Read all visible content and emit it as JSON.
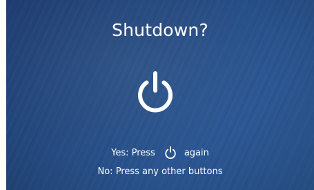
{
  "dialog": {
    "title": "Shutdown?",
    "icon": "power-icon",
    "yes_prefix": "Yes: Press",
    "yes_icon": "power-icon",
    "yes_suffix": "again",
    "no_text": "No: Press any other buttons"
  },
  "colors": {
    "background_dark": "#1f3d70",
    "background_light": "#2e5d9c",
    "foreground": "#ffffff"
  }
}
